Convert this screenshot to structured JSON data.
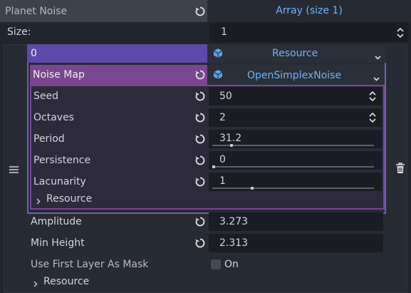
{
  "header": {
    "property_label": "Planet Noise",
    "value_label": "Array (size 1)"
  },
  "size_row": {
    "label": "Size:",
    "value": "1"
  },
  "element": {
    "index": "0",
    "type_label": "Resource",
    "noise_map": {
      "label": "Noise Map",
      "type_label": "OpenSimplexNoise",
      "properties": {
        "seed": {
          "label": "Seed",
          "value": "50"
        },
        "octaves": {
          "label": "Octaves",
          "value": "2"
        },
        "period": {
          "label": "Period",
          "value": "31.2",
          "slider": 0.11
        },
        "persistence": {
          "label": "Persistence",
          "value": "0",
          "slider": 0.0
        },
        "lacunarity": {
          "label": "Lacunarity",
          "value": "1",
          "slider": 0.24
        }
      },
      "resource_section": "Resource"
    },
    "amplitude": {
      "label": "Amplitude",
      "value": "3.273"
    },
    "min_height": {
      "label": "Min Height",
      "value": "2.313"
    },
    "use_mask": {
      "label": "Use First Layer As Mask",
      "value": "On"
    },
    "resource_section": "Resource"
  },
  "icons": {
    "revert": "revert-icon",
    "drag": "drag-handle-icon",
    "delete": "trash-icon",
    "resource": "cube-icon"
  },
  "colors": {
    "accent": "#6eb3f4",
    "element_purple": "#5d4aa8",
    "noise_purple": "#7a4690"
  }
}
